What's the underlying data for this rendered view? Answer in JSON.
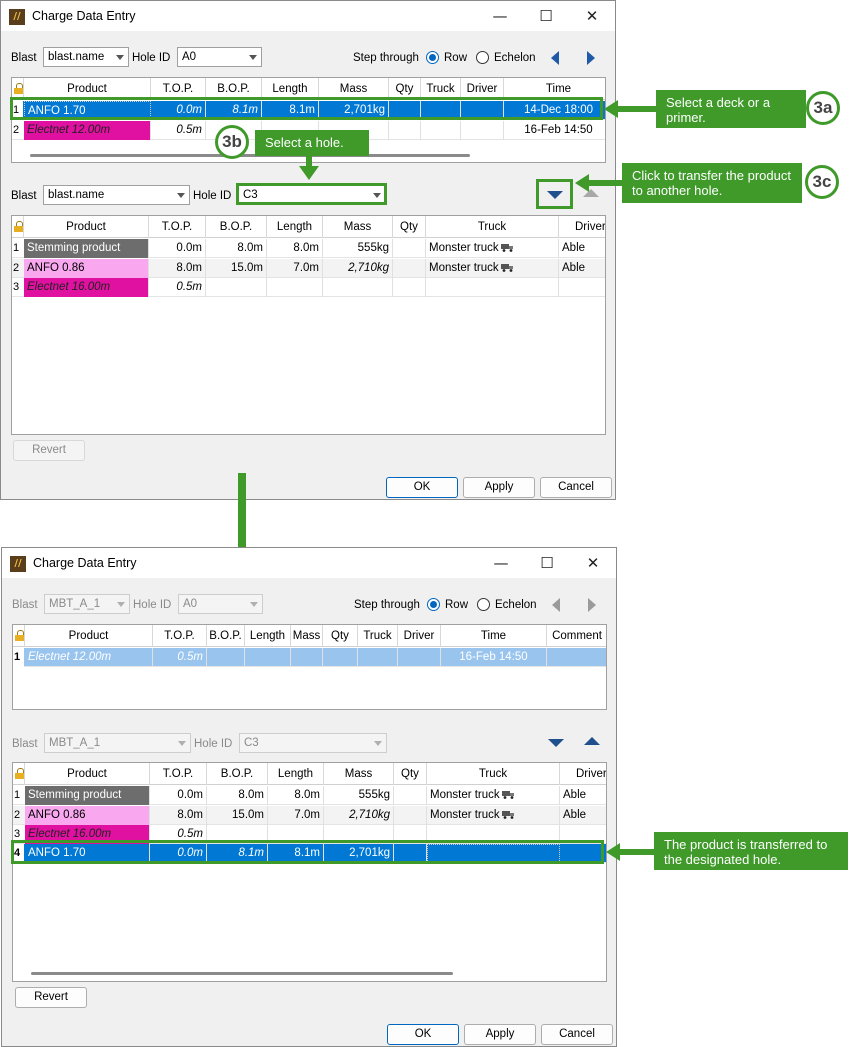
{
  "window1": {
    "title": "Charge Data Entry",
    "minimize": "—",
    "maximize": "☐",
    "close": "✕",
    "top": {
      "blast_label": "Blast",
      "blast_value": "blast.name",
      "holeid_label": "Hole ID",
      "holeid_value": "A0",
      "step_label": "Step through",
      "radio_row": "Row",
      "radio_echelon": "Echelon"
    },
    "grid1": {
      "columns": [
        "Product",
        "T.O.P.",
        "B.O.P.",
        "Length",
        "Mass",
        "Qty",
        "Truck",
        "Driver",
        "Time"
      ],
      "rows": [
        {
          "n": "1",
          "product": "ANFO 1.70",
          "top": "0.0m",
          "bop": "8.1m",
          "length": "8.1m",
          "mass": "2,701kg",
          "qty": "",
          "truck": "",
          "driver": "",
          "time": "14-Dec 18:00"
        },
        {
          "n": "2",
          "product": "Electnet 12.00m",
          "top": "0.5m",
          "bop": "",
          "length": "",
          "mass": "",
          "qty": "",
          "truck": "",
          "driver": "",
          "time": "16-Feb 14:50"
        }
      ]
    },
    "bottom": {
      "blast_label": "Blast",
      "blast_value": "blast.name",
      "holeid_label": "Hole ID",
      "holeid_value": "C3"
    },
    "grid2": {
      "columns": [
        "Product",
        "T.O.P.",
        "B.O.P.",
        "Length",
        "Mass",
        "Qty",
        "Truck",
        "Driver"
      ],
      "rows": [
        {
          "n": "1",
          "product": "Stemming product",
          "top": "0.0m",
          "bop": "8.0m",
          "length": "8.0m",
          "mass": "555kg",
          "qty": "",
          "truck": "Monster truck",
          "driver": "Able"
        },
        {
          "n": "2",
          "product": "ANFO 0.86",
          "top": "8.0m",
          "bop": "15.0m",
          "length": "7.0m",
          "mass": "2,710kg",
          "qty": "",
          "truck": "Monster truck",
          "driver": "Able"
        },
        {
          "n": "3",
          "product": "Electnet 16.00m",
          "top": "0.5m",
          "bop": "",
          "length": "",
          "mass": "",
          "qty": "",
          "truck": "",
          "driver": ""
        }
      ]
    },
    "revert": "Revert",
    "ok": "OK",
    "apply": "Apply",
    "cancel": "Cancel"
  },
  "window2": {
    "title": "Charge Data Entry",
    "minimize": "—",
    "maximize": "☐",
    "close": "✕",
    "top": {
      "blast_label": "Blast",
      "blast_value": "MBT_A_1",
      "holeid_label": "Hole ID",
      "holeid_value": "A0",
      "step_label": "Step through",
      "radio_row": "Row",
      "radio_echelon": "Echelon"
    },
    "grid1": {
      "columns": [
        "Product",
        "T.O.P.",
        "B.O.P.",
        "Length",
        "Mass",
        "Qty",
        "Truck",
        "Driver",
        "Time",
        "Comment"
      ],
      "rows": [
        {
          "n": "1",
          "product": "Electnet 12.00m",
          "top": "0.5m",
          "time": "16-Feb 14:50"
        }
      ]
    },
    "bottom": {
      "blast_label": "Blast",
      "blast_value": "MBT_A_1",
      "holeid_label": "Hole ID",
      "holeid_value": "C3"
    },
    "grid2": {
      "columns": [
        "Product",
        "T.O.P.",
        "B.O.P.",
        "Length",
        "Mass",
        "Qty",
        "Truck",
        "Driver"
      ],
      "rows": [
        {
          "n": "1",
          "product": "Stemming product",
          "top": "0.0m",
          "bop": "8.0m",
          "length": "8.0m",
          "mass": "555kg",
          "truck": "Monster truck",
          "driver": "Able"
        },
        {
          "n": "2",
          "product": "ANFO 0.86",
          "top": "8.0m",
          "bop": "15.0m",
          "length": "7.0m",
          "mass": "2,710kg",
          "truck": "Monster truck",
          "driver": "Able"
        },
        {
          "n": "3",
          "product": "Electnet 16.00m",
          "top": "0.5m"
        },
        {
          "n": "4",
          "product": "ANFO 1.70",
          "top": "0.0m",
          "bop": "8.1m",
          "length": "8.1m",
          "mass": "2,701kg"
        }
      ]
    },
    "revert": "Revert",
    "ok": "OK",
    "apply": "Apply",
    "cancel": "Cancel"
  },
  "annotations": {
    "badge_3a": "3a",
    "callout_3a": "Select a deck or a primer.",
    "badge_3b": "3b",
    "callout_3b": "Select a hole.",
    "badge_3c": "3c",
    "callout_3c": "Click to transfer the product to another hole.",
    "callout_final": "The product is transferred to the designated hole."
  },
  "colors": {
    "selection": "#0078d4",
    "stemming": "#6d6d6d",
    "anfo086": "#f9a8f0",
    "electnet": "#e010a0",
    "annotation_green": "#3f9a2a",
    "selection_light": "#99c4ee"
  }
}
